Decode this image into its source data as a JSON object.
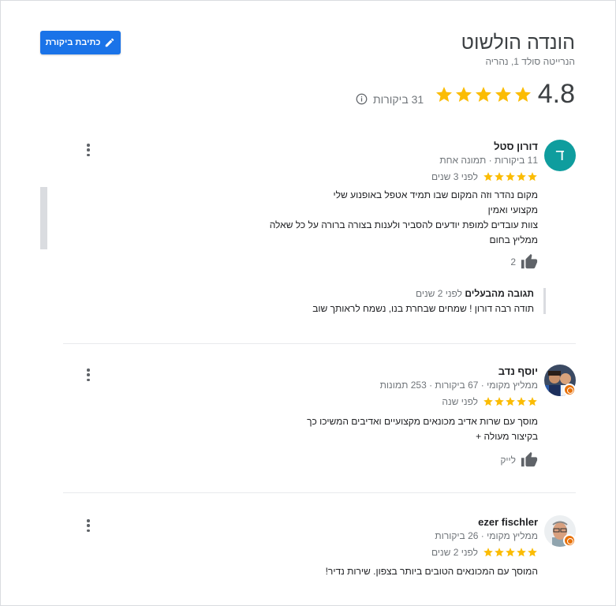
{
  "place": {
    "name": "הונדה הולשוט",
    "address": "הנרייטה סולד 1, נהריה",
    "rating": "4.8",
    "rating_stars": 5,
    "review_count": "31 ביקורות",
    "write_review_label": "כתיבת ביקורת"
  },
  "colors": {
    "accent": "#1a73e8",
    "star": "#fbbc04",
    "avatar_teal": "#0f9d9e",
    "local_guide_badge": "#e8710a"
  },
  "reviews": [
    {
      "avatar_letter": "ד",
      "name": "דורון סטל",
      "meta": "11 ביקורות · תמונה אחת",
      "stars": 5,
      "date": "לפני 3 שנים",
      "text": [
        "מקום נהדר וזה המקום  שבו תמיד אטפל באופנוע שלי",
        "מקצועי ואמין",
        "צוות עובדים למופת יודעים להסביר ולענות בצורה ברורה על כל שאלה",
        "ממליץ בחום"
      ],
      "likes": "2",
      "owner_response": {
        "label": "תגובה מהבעלים",
        "date": "לפני 2 שנים",
        "text": "תודה רבה דורון ! שמחים שבחרת בנו, נשמח לראותך שוב"
      }
    },
    {
      "name": "יוסף נדב",
      "meta": "ממליץ מקומי · 67 ביקורות · 253 תמונות",
      "stars": 5,
      "date": "לפני שנה",
      "text": [
        "מוסך עם שרות אדיב מכונאים מקצועיים ואדיבים המשיכו כך",
        "בקיצור מעולה +"
      ],
      "likes": "לייק"
    },
    {
      "name": "ezer fischler",
      "meta": "ממליץ מקומי · 26 ביקורות",
      "stars": 5,
      "date": "לפני 2 שנים",
      "text": [
        "המוסך עם המכונאים הטובים ביותר בצפון. שירות נדיר!"
      ]
    }
  ]
}
